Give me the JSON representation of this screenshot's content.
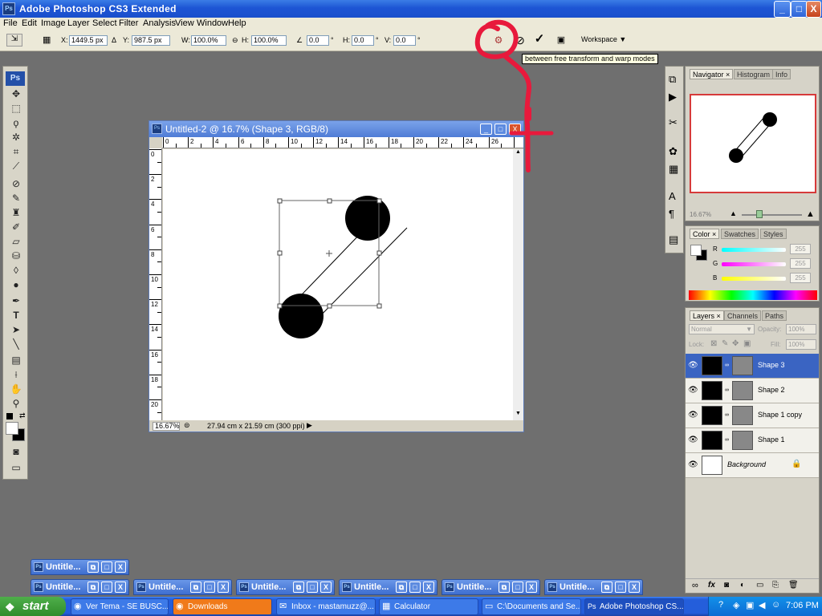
{
  "app": {
    "title": "Adobe Photoshop CS3 Extended",
    "window_controls": [
      "_",
      "□",
      "X"
    ]
  },
  "menu": [
    "File",
    "Edit",
    "Image",
    "Layer",
    "Select",
    "Filter",
    "Analysis",
    "View",
    "Window",
    "Help"
  ],
  "options": {
    "x_label": "X:",
    "x_value": "1449.5 px",
    "y_label": "Y:",
    "y_value": "987.5 px",
    "w_label": "W:",
    "w_value": "100.0%",
    "h_label": "H:",
    "h_value": "100.0%",
    "angle_value": "0.0",
    "hskew_label": "H:",
    "hskew_value": "0.0",
    "vskew_label": "V:",
    "vskew_value": "0.0",
    "degree_symbol": "°",
    "workspace_label": "Workspace",
    "tooltip": "between free transform and warp modes"
  },
  "toolbox": {
    "logo": "Ps"
  },
  "document": {
    "title": "Untitled-2 @ 16.7% (Shape 3, RGB/8)",
    "zoom": "16.67%",
    "doc_size": "27.94 cm x 21.59 cm (300 ppi)",
    "ruler_top": [
      "0",
      "2",
      "4",
      "6",
      "8",
      "10",
      "12",
      "14",
      "16",
      "18",
      "20",
      "22",
      "24",
      "26"
    ],
    "ruler_left": [
      "0",
      "2",
      "4",
      "6",
      "8",
      "10",
      "12",
      "14",
      "16",
      "18",
      "20"
    ]
  },
  "navigator": {
    "tabs": [
      "Navigator",
      "Histogram",
      "Info"
    ],
    "zoom": "16.67%"
  },
  "color": {
    "tabs": [
      "Color",
      "Swatches",
      "Styles"
    ],
    "r_label": "R",
    "g_label": "G",
    "b_label": "B",
    "r_value": "255",
    "g_value": "255",
    "b_value": "255"
  },
  "layers": {
    "tabs": [
      "Layers",
      "Channels",
      "Paths"
    ],
    "blend_mode": "Normal",
    "opacity_label": "Opacity:",
    "opacity_value": "100%",
    "lock_label": "Lock:",
    "fill_label": "Fill:",
    "fill_value": "100%",
    "items": [
      {
        "name": "Shape 3",
        "selected": true
      },
      {
        "name": "Shape 2",
        "selected": false
      },
      {
        "name": "Shape 1 copy",
        "selected": false
      },
      {
        "name": "Shape 1",
        "selected": false
      },
      {
        "name": "Background",
        "selected": false
      }
    ]
  },
  "minimized_docs": {
    "label": "Untitle..."
  },
  "taskbar": {
    "start": "start",
    "tasks": [
      {
        "label": "Ver Tema - SE BUSC..."
      },
      {
        "label": "Downloads"
      },
      {
        "label": "Inbox - mastamuzz@..."
      },
      {
        "label": "Calculator"
      },
      {
        "label": "C:\\Documents and Se..."
      },
      {
        "label": "Adobe Photoshop CS..."
      }
    ],
    "clock": "7:06 PM"
  },
  "annotation": {
    "color": "#e8193c"
  }
}
